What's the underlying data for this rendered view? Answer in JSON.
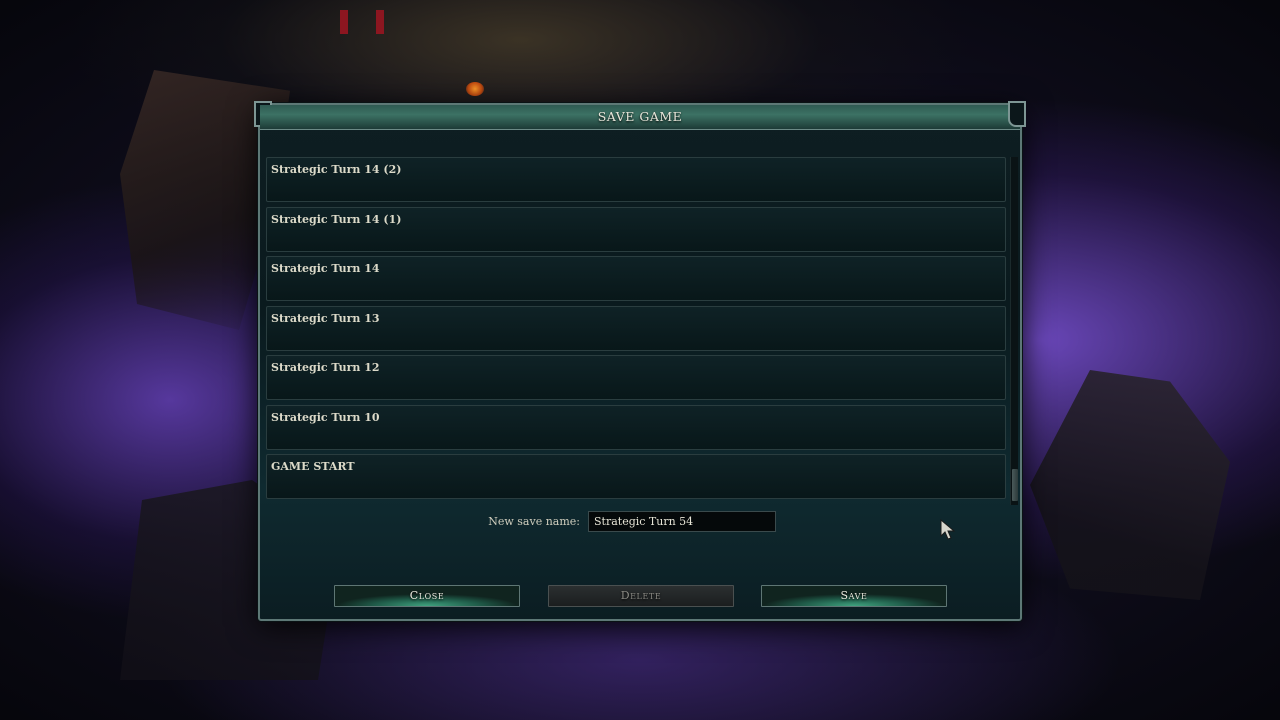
{
  "dialog": {
    "title": "SAVE GAME",
    "saves": [
      {
        "label": "Strategic Turn 14 (2)"
      },
      {
        "label": "Strategic Turn 14 (1)"
      },
      {
        "label": "Strategic Turn 14"
      },
      {
        "label": "Strategic Turn 13"
      },
      {
        "label": "Strategic Turn 12"
      },
      {
        "label": "Strategic Turn 10"
      },
      {
        "label": "GAME START"
      }
    ],
    "new_save_label": "New save name:",
    "new_save_value": "Strategic Turn 54",
    "buttons": {
      "close": "Close",
      "delete": "Delete",
      "save": "Save"
    }
  },
  "scroll_position": 1.0,
  "colors": {
    "accent_green": "#3fa37f",
    "text": "#dcdac9",
    "frame": "#5d7876"
  },
  "icons": {
    "cursor": "mouse-pointer-icon"
  }
}
